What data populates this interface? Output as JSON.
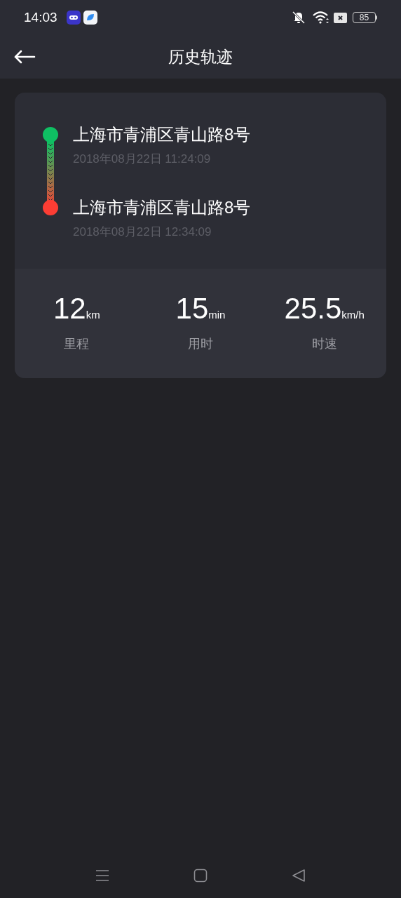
{
  "status_bar": {
    "time": "14:03",
    "battery": "85"
  },
  "header": {
    "title": "历史轨迹"
  },
  "track": [
    {
      "color": "#0fbf63",
      "address": "上海市青浦区青山路8号",
      "time": "2018年08月22日 11:24:09"
    },
    {
      "color": "#fc3d34",
      "address": "上海市青浦区青山路8号",
      "time": "2018年08月22日 12:34:09"
    }
  ],
  "stats": [
    {
      "value": "12",
      "unit": "km",
      "label": "里程"
    },
    {
      "value": "15",
      "unit": "min",
      "label": "用时"
    },
    {
      "value": "25.5",
      "unit": "km/h",
      "label": "时速"
    }
  ]
}
